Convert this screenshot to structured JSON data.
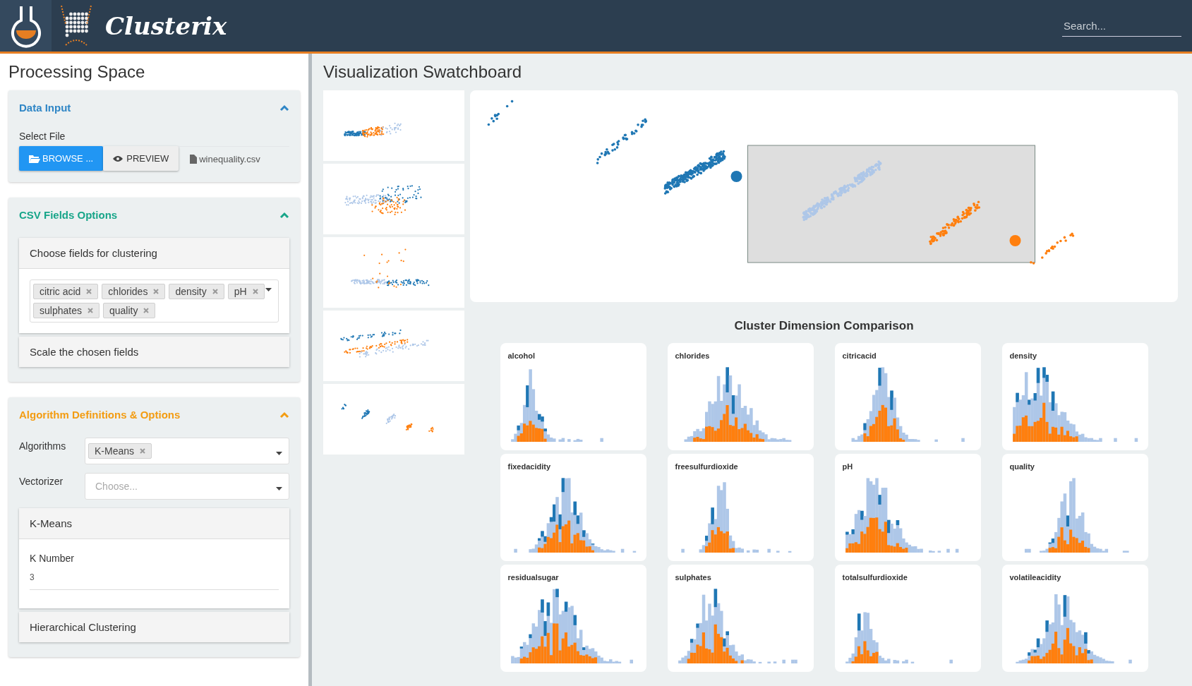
{
  "header": {
    "brand": "Clusterix",
    "search": {
      "placeholder": "Search..."
    }
  },
  "processing": {
    "title": "Processing Space",
    "data_input": {
      "title": "Data Input",
      "color": "#2f86c6",
      "expanded": true,
      "file_label": "Select File",
      "browse": "BROWSE ...",
      "preview": "PREVIEW",
      "file_name": "winequality.csv"
    },
    "csv_fields": {
      "title": "CSV Fields Options",
      "color": "#17a589",
      "expanded": true,
      "sections": [
        {
          "title": "Choose fields for clustering",
          "expanded": true,
          "tags": [
            "citric acid",
            "chlorides",
            "density",
            "pH",
            "sulphates",
            "quality"
          ]
        },
        {
          "title": "Scale the chosen fields",
          "expanded": false
        }
      ]
    },
    "algorithms": {
      "title": "Algorithm Definitions & Options",
      "color": "#f39c12",
      "expanded": true,
      "algorithms_label": "Algorithms",
      "algorithm_tags": [
        "K-Means"
      ],
      "vectorizer_label": "Vectorizer",
      "vectorizer_placeholder": "Choose...",
      "sections": [
        {
          "title": "K-Means",
          "expanded": true,
          "field_label": "K Number",
          "field_value": "3"
        },
        {
          "title": "Hierarchical Clustering",
          "expanded": false
        }
      ]
    }
  },
  "swatchboard": {
    "title": "Visualization Swatchboard",
    "comparison_title": "Cluster Dimension Comparison",
    "histograms": [
      {
        "label": "alcohol"
      },
      {
        "label": "chlorides"
      },
      {
        "label": "citricacid"
      },
      {
        "label": "density"
      },
      {
        "label": "fixedacidity"
      },
      {
        "label": "freesulfurdioxide"
      },
      {
        "label": "pH"
      },
      {
        "label": "quality"
      },
      {
        "label": "residualsugar"
      },
      {
        "label": "sulphates"
      },
      {
        "label": "totalsulfurdioxide"
      },
      {
        "label": "volatileacidity"
      }
    ]
  }
}
